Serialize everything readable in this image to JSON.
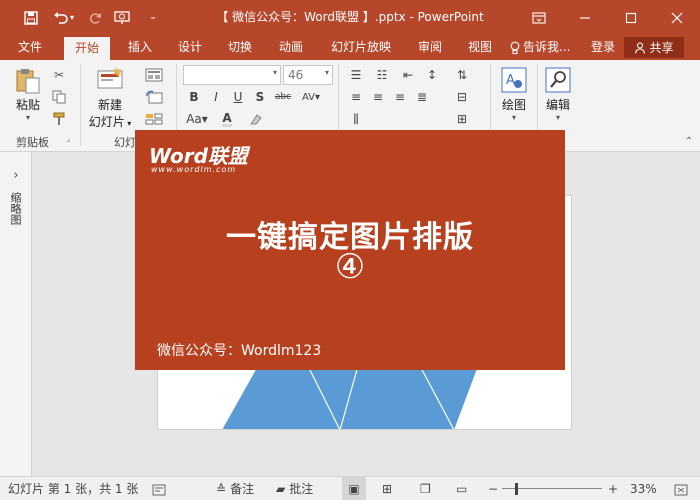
{
  "app": {
    "title": "【 微信公众号：Word联盟 】.pptx - PowerPoint",
    "accent": "#b7472a"
  },
  "tabs": [
    {
      "label": "文件",
      "active": false
    },
    {
      "label": "开始",
      "active": true
    },
    {
      "label": "插入",
      "active": false
    },
    {
      "label": "设计",
      "active": false
    },
    {
      "label": "切换",
      "active": false
    },
    {
      "label": "动画",
      "active": false
    },
    {
      "label": "幻灯片放映",
      "active": false
    },
    {
      "label": "审阅",
      "active": false
    },
    {
      "label": "视图",
      "active": false
    }
  ],
  "tellme": "告诉我...",
  "signin": "登录",
  "share": "共享",
  "ribbon": {
    "paste_label": "粘贴",
    "new_slide_line1": "新建",
    "new_slide_line2": "幻灯片",
    "font_size": "46",
    "draw_label": "绘图",
    "edit_label": "编辑",
    "groups": {
      "clipboard": "剪贴板",
      "slides": "幻灯"
    }
  },
  "left_panel": {
    "caption": "缩略图"
  },
  "overlay": {
    "logo": "Word联盟",
    "logo_sub": "www.wordlm.com",
    "headline": "一键搞定图片排版",
    "number": "④",
    "wechat": "微信公众号：Wordlm123"
  },
  "status": {
    "slide_info": "幻灯片 第 1 张，共 1 张",
    "notes": "备注",
    "comments": "批注",
    "zoom": "33%"
  },
  "colors": {
    "overlay_bg": "#b7411f",
    "shape_blue": "#5b9bd5"
  }
}
